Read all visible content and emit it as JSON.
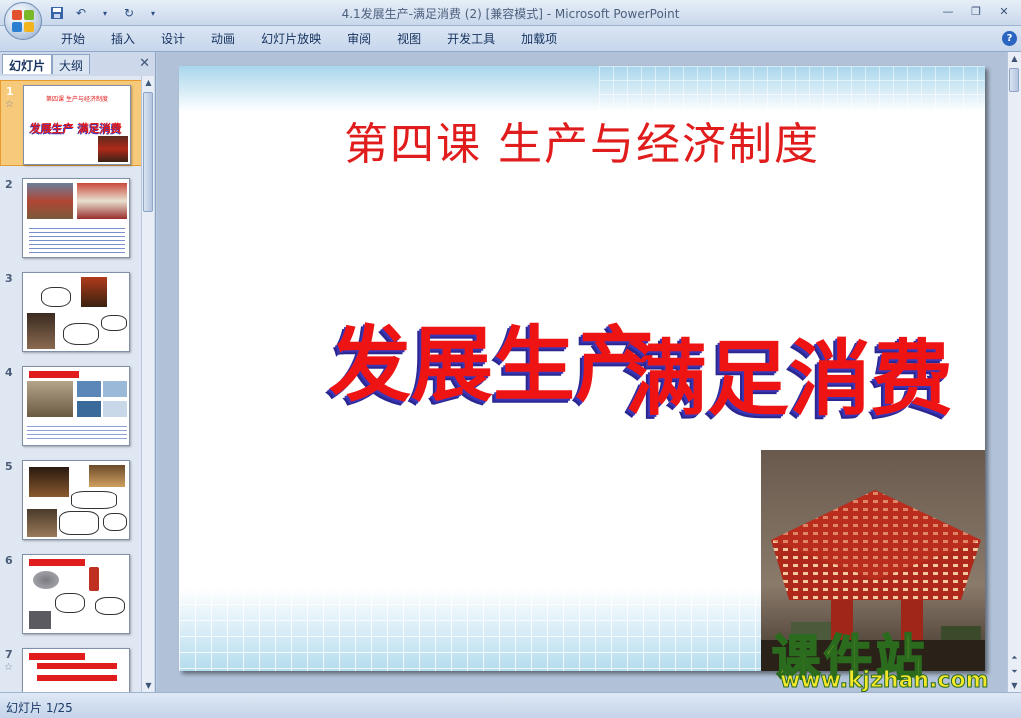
{
  "window": {
    "title": "4.1发展生产-满足消费 (2) [兼容模式] - Microsoft PowerPoint"
  },
  "ribbon": {
    "tabs": [
      "开始",
      "插入",
      "设计",
      "动画",
      "幻灯片放映",
      "审阅",
      "视图",
      "开发工具",
      "加载项"
    ]
  },
  "pane": {
    "tab_slides": "幻灯片",
    "tab_outline": "大纲",
    "thumbnails": [
      {
        "num": "1",
        "title": "发展生产  满足消费",
        "subtitle": "第四课  生产与经济制度"
      },
      {
        "num": "2"
      },
      {
        "num": "3"
      },
      {
        "num": "4"
      },
      {
        "num": "5"
      },
      {
        "num": "6"
      },
      {
        "num": "7"
      }
    ]
  },
  "slide": {
    "title": "第四课   生产与经济制度",
    "headline_left": "发展生产",
    "headline_right": "满足消费"
  },
  "status": {
    "slide_counter": "幻灯片 1/25"
  },
  "watermark": {
    "brand": "课件站",
    "url": "www.kjzhan.com"
  },
  "colors": {
    "title_red": "#e11c1c",
    "selected_thumb": "#f7c97a"
  }
}
